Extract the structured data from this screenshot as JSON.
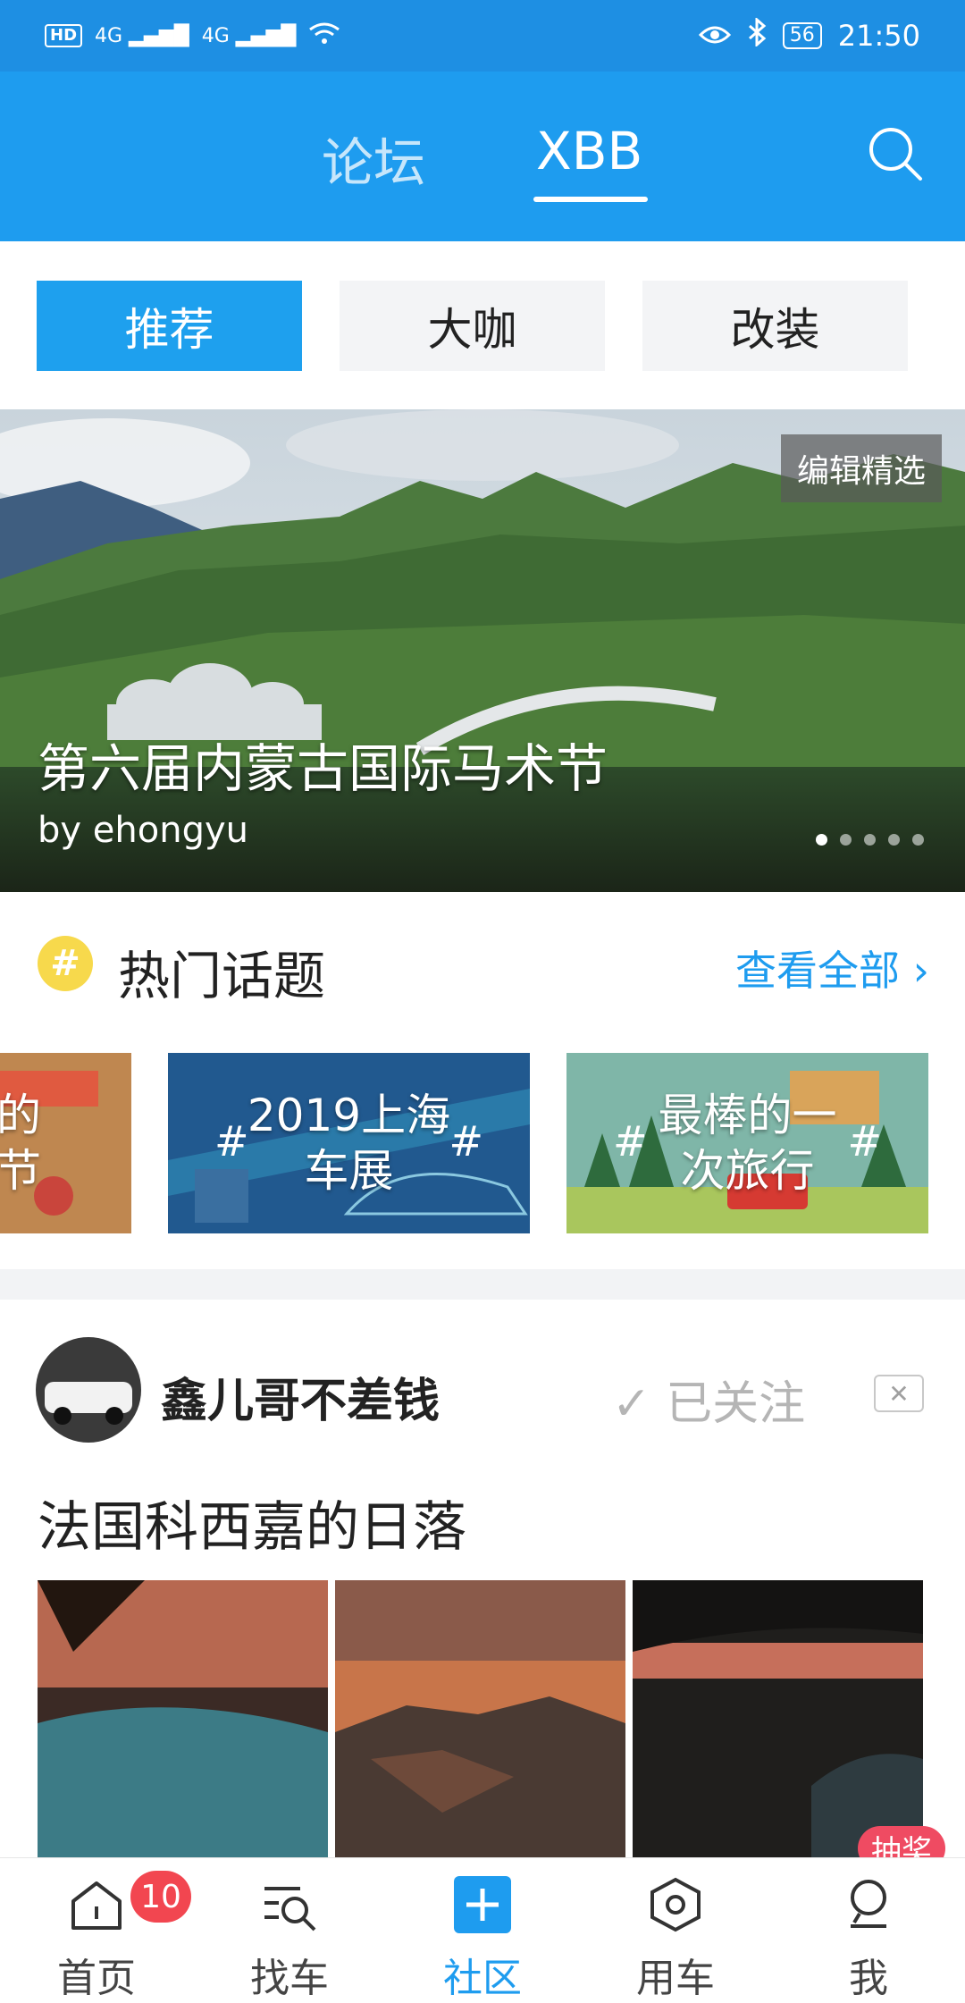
{
  "status_bar": {
    "hd": "HD",
    "net1": "4G",
    "net2": "4G",
    "battery": "56",
    "time": "21:50"
  },
  "header": {
    "tabs": [
      {
        "label": "论坛"
      },
      {
        "label": "XBB"
      }
    ],
    "search_icon": "search-icon"
  },
  "segments": [
    {
      "label": "推荐",
      "active": true
    },
    {
      "label": "大咖"
    },
    {
      "label": "改装"
    }
  ],
  "banner": {
    "badge": "编辑精选",
    "title": "第六届内蒙古国际马术节",
    "author": "by ehongyu",
    "slides": 5,
    "current_slide": 1
  },
  "hot_topics": {
    "icon": "#",
    "title": "热门话题",
    "see_all": "查看全部",
    "items": [
      {
        "label": "的\n节"
      },
      {
        "label": "2019上海\n车展"
      },
      {
        "label": "最棒的一\n次旅行"
      }
    ]
  },
  "post": {
    "user": "鑫儿哥不差钱",
    "follow": "已关注",
    "title": "法国科西嘉的日落"
  },
  "tabbar": {
    "items": [
      {
        "label": "首页",
        "icon": "home-icon"
      },
      {
        "label": "找车",
        "icon": "find-car-icon"
      },
      {
        "label": "社区",
        "icon": "community-plus-icon",
        "active": true
      },
      {
        "label": "用车",
        "icon": "use-car-icon"
      },
      {
        "label": "我",
        "icon": "profile-icon"
      }
    ],
    "home_badge": "10",
    "lottery": "抽奖"
  },
  "colors": {
    "primary": "#1e9cef",
    "badge": "#f24650"
  }
}
